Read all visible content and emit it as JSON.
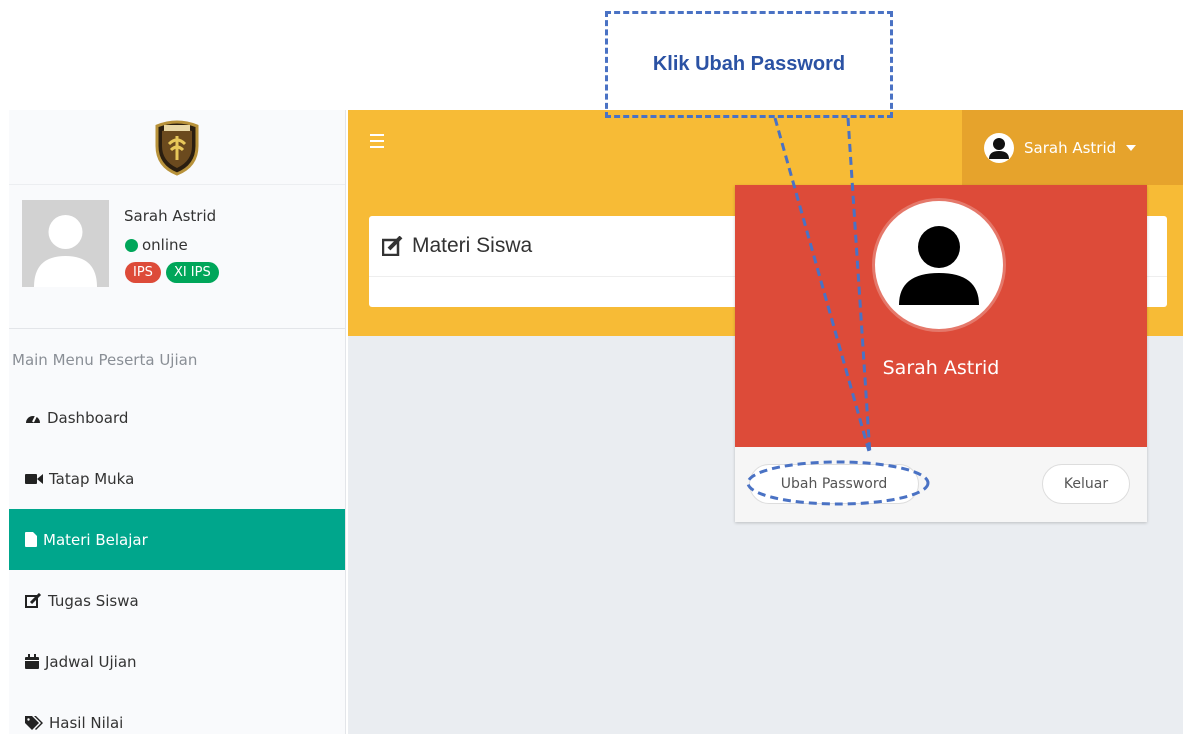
{
  "annotation": {
    "callout_text": "Klik Ubah Password"
  },
  "sidebar": {
    "user": {
      "name": "Sarah Astrid",
      "status": "online",
      "badges": [
        "IPS",
        "XI IPS"
      ]
    },
    "menu_header": "Main Menu Peserta Ujian",
    "items": [
      {
        "label": "Dashboard",
        "icon": "dashboard-icon"
      },
      {
        "label": "Tatap Muka",
        "icon": "video-camera-icon"
      },
      {
        "label": "Materi Belajar",
        "icon": "file-icon",
        "active": true
      },
      {
        "label": "Tugas Siswa",
        "icon": "edit-icon"
      },
      {
        "label": "Jadwal Ujian",
        "icon": "calendar-icon"
      },
      {
        "label": "Hasil Nilai",
        "icon": "tags-icon"
      }
    ]
  },
  "topbar": {
    "user_name": "Sarah Astrid"
  },
  "content": {
    "page_title": "Materi Siswa"
  },
  "dropdown": {
    "name": "Sarah Astrid",
    "change_password_label": "Ubah Password",
    "logout_label": "Keluar"
  },
  "colors": {
    "header": "#f7bb36",
    "user_menu": "#e6a32c",
    "active_menu": "#00a68c",
    "dropdown_header": "#dd4b39",
    "annotation": "#4a72c4"
  }
}
